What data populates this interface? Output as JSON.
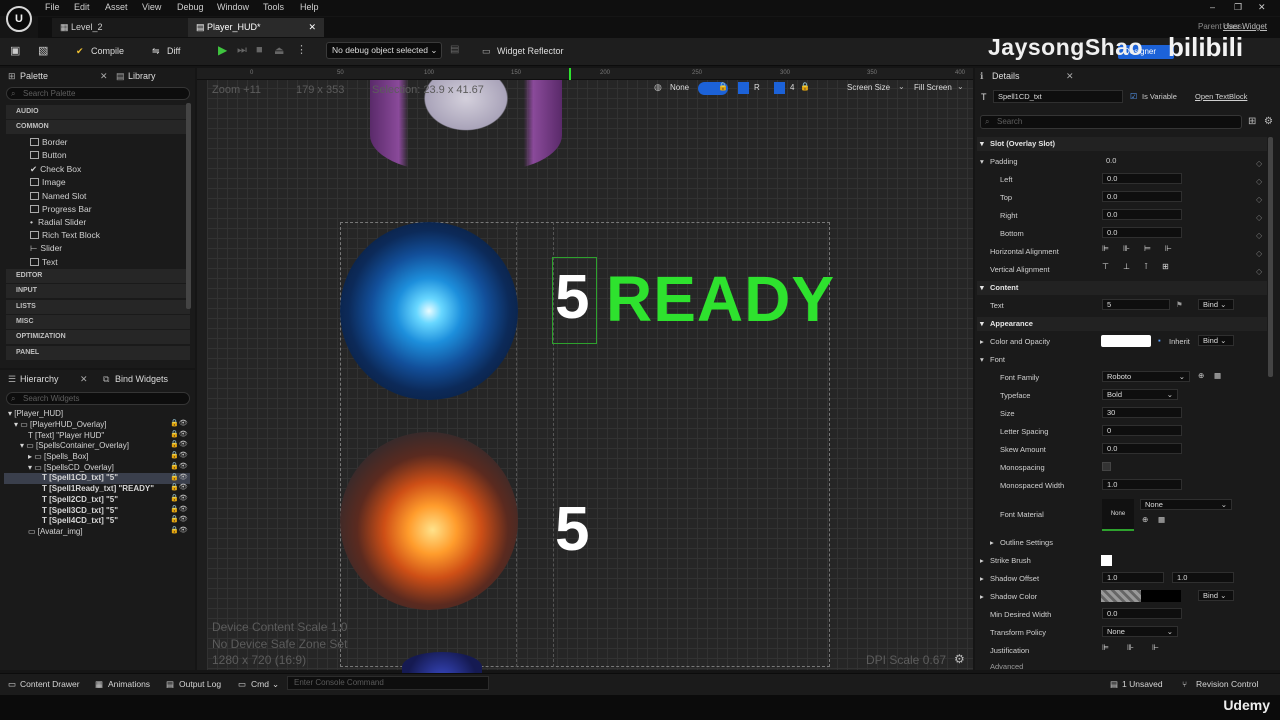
{
  "menu": [
    "File",
    "Edit",
    "Asset",
    "View",
    "Debug",
    "Window",
    "Tools",
    "Help"
  ],
  "tabs": [
    {
      "label": "Level_2"
    },
    {
      "label": "Player_HUD*"
    }
  ],
  "toolbar": {
    "compile": "Compile",
    "diff": "Diff",
    "debug_select": "No debug object selected",
    "widget_reflector": "Widget Reflector",
    "parent_class": "Parent class:",
    "user_widget": "User Widget",
    "designer": "Designer"
  },
  "watermark": {
    "name": "JaysongShao",
    "brand": "bilibili"
  },
  "palette": {
    "tab": "Palette",
    "library_tab": "Library",
    "search_placeholder": "Search Palette",
    "categories_top": [
      "AUDIO",
      "COMMON"
    ],
    "common_items": [
      "Border",
      "Button",
      "Check Box",
      "Image",
      "Named Slot",
      "Progress Bar",
      "Radial Slider",
      "Rich Text Block",
      "Slider",
      "Text"
    ],
    "categories_bottom": [
      "EDITOR",
      "INPUT",
      "LISTS",
      "MISC",
      "OPTIMIZATION",
      "PANEL"
    ]
  },
  "hierarchy": {
    "tab": "Hierarchy",
    "bind_tab": "Bind Widgets",
    "search_placeholder": "Search Widgets",
    "items": [
      "[Player_HUD]",
      "[PlayerHUD_Overlay]",
      "[Text] \"Player HUD\"",
      "[SpellsContainer_Overlay]",
      "[Spells_Box]",
      "[SpellsCD_Overlay]",
      "[Spell1CD_txt] \"5\"",
      "[Spell1Ready_txt] \"READY\"",
      "[Spell2CD_txt] \"5\"",
      "[Spell3CD_txt] \"5\"",
      "[Spell4CD_txt] \"5\"",
      "[Avatar_img]"
    ]
  },
  "viewport": {
    "zoom": "Zoom +11",
    "size_readout": "179 x 353",
    "selection": "Selection: 23.9 x 41.67",
    "none": "None",
    "r": "R",
    "grid_num": "4",
    "screen_size": "Screen Size",
    "fill_screen": "Fill Screen",
    "ruler": [
      "0",
      "50",
      "100",
      "150",
      "200",
      "250",
      "300",
      "350",
      "400"
    ],
    "spell1_cd": "5",
    "spell1_ready": "READY",
    "spell2_cd": "5",
    "device_scale": "Device Content Scale 1.0",
    "safe_zone": "No Device Safe Zone Set",
    "resolution": "1280 x 720 (16:9)",
    "dpi": "DPI Scale 0.67"
  },
  "details": {
    "tab": "Details",
    "widget_name": "Spell1CD_txt",
    "is_variable": "Is Variable",
    "open_textblock": "Open TextBlock",
    "search_placeholder": "Search",
    "slot_section": "Slot (Overlay Slot)",
    "padding": {
      "label": "Padding",
      "value": "0.0",
      "left": "Left",
      "left_v": "0.0",
      "top": "Top",
      "top_v": "0.0",
      "right": "Right",
      "right_v": "0.0",
      "bottom": "Bottom",
      "bottom_v": "0.0"
    },
    "h_align": "Horizontal Alignment",
    "v_align": "Vertical Alignment",
    "content_section": "Content",
    "text_label": "Text",
    "text_value": "5",
    "bind": "Bind",
    "appearance_section": "Appearance",
    "color_opacity": "Color and Opacity",
    "inherit": "Inherit",
    "font_label": "Font",
    "font_family": "Font Family",
    "font_family_v": "Roboto",
    "typeface": "Typeface",
    "typeface_v": "Bold",
    "size": "Size",
    "size_v": "30",
    "letter_spacing": "Letter Spacing",
    "letter_spacing_v": "0",
    "skew": "Skew Amount",
    "skew_v": "0.0",
    "monospacing": "Monospacing",
    "mono_width": "Monospaced Width",
    "mono_width_v": "1.0",
    "font_material": "Font Material",
    "font_material_v": "None",
    "font_material_thumb": "None",
    "outline": "Outline Settings",
    "strike": "Strike Brush",
    "shadow_offset": "Shadow Offset",
    "shadow_x": "1.0",
    "shadow_y": "1.0",
    "shadow_color": "Shadow Color",
    "min_width": "Min Desired Width",
    "min_width_v": "0.0",
    "transform_policy": "Transform Policy",
    "transform_policy_v": "None",
    "justification": "Justification",
    "advanced": "Advanced"
  },
  "status": {
    "content_drawer": "Content Drawer",
    "animations": "Animations",
    "output_log": "Output Log",
    "cmd": "Cmd",
    "console_placeholder": "Enter Console Command",
    "unsaved": "1 Unsaved",
    "revision": "Revision Control"
  },
  "udemy": "Udemy",
  "colors": {
    "ready_green": "#2ee22e",
    "accent_blue": "#1c62d8",
    "panel_bg": "#1a1a1a"
  }
}
